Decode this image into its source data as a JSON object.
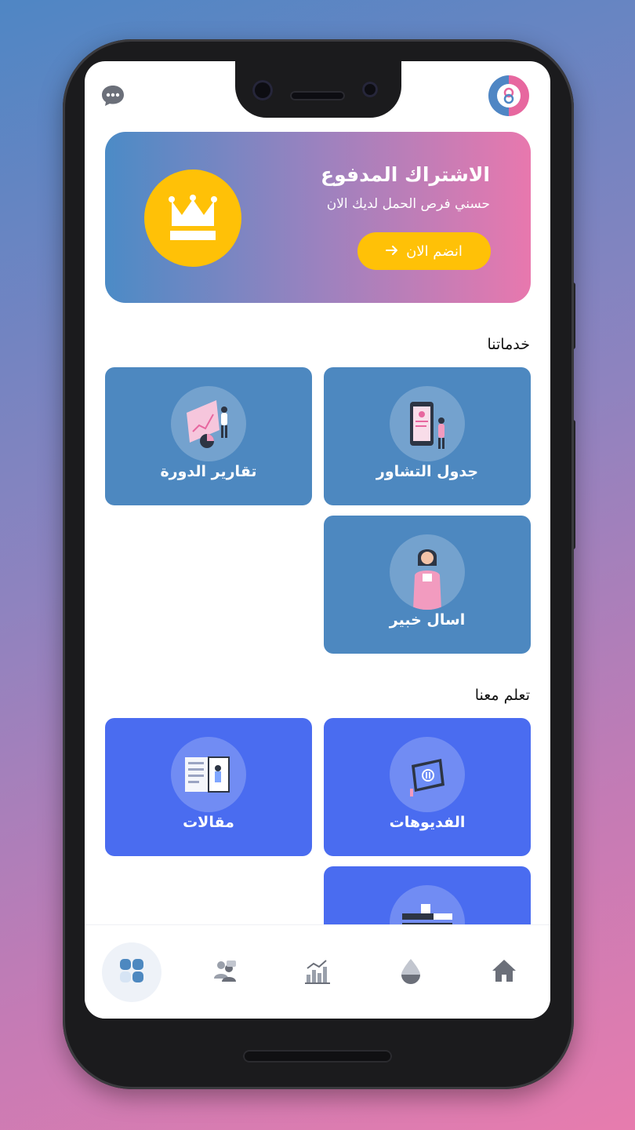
{
  "header": {
    "chat_icon": "chat-bubble-icon",
    "logo_icon": "app-logo-icon"
  },
  "promo": {
    "title": "الاشتراك المدفوع",
    "subtitle": "حسني فرص الحمل لديك الان",
    "button_label": "انضم الان",
    "button_icon": "arrow-right-icon",
    "badge_icon": "crown-icon",
    "colors": {
      "gradient_start": "#4b8bc6",
      "gradient_end": "#e878ae",
      "accent": "#ffc107"
    }
  },
  "services": {
    "title": "خدماتنا",
    "items": [
      {
        "label": "جدول التشاور",
        "icon": "consultation-schedule-illustration"
      },
      {
        "label": "تقارير الدورة",
        "icon": "cycle-reports-illustration"
      },
      {
        "label": "اسال خبير",
        "icon": "ask-expert-illustration"
      }
    ],
    "color": "#4d88c0"
  },
  "learn": {
    "title": "تعلم معنا",
    "items": [
      {
        "label": "الفديوهات",
        "icon": "videos-illustration"
      },
      {
        "label": "مقالات",
        "icon": "articles-illustration"
      },
      {
        "label": "",
        "icon": "books-illustration"
      }
    ],
    "color": "#4a6cf0"
  },
  "nav": {
    "items": [
      {
        "name": "dashboard",
        "icon": "grid-icon",
        "active": true
      },
      {
        "name": "community",
        "icon": "users-icon",
        "active": false
      },
      {
        "name": "stats",
        "icon": "chart-icon",
        "active": false
      },
      {
        "name": "cycle",
        "icon": "drop-icon",
        "active": false
      },
      {
        "name": "home",
        "icon": "home-icon",
        "active": false
      }
    ]
  }
}
